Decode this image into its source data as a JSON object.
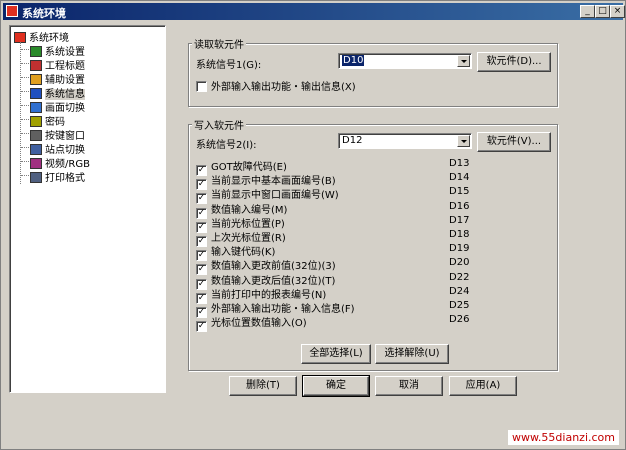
{
  "window": {
    "title": "系统环境",
    "min": "_",
    "max": "□",
    "close": "×"
  },
  "tree": {
    "root": "系统环境",
    "items": [
      {
        "label": "系统设置",
        "icon": "system-settings-icon",
        "selected": false
      },
      {
        "label": "工程标题",
        "icon": "project-title-icon",
        "selected": false
      },
      {
        "label": "辅助设置",
        "icon": "aux-settings-icon",
        "selected": false
      },
      {
        "label": "系统信息",
        "icon": "system-info-icon",
        "selected": true
      },
      {
        "label": "画面切换",
        "icon": "screen-switch-icon",
        "selected": false
      },
      {
        "label": "密码",
        "icon": "key-icon",
        "selected": false
      },
      {
        "label": "按键窗口",
        "icon": "key-window-icon",
        "selected": false
      },
      {
        "label": "站点切换",
        "icon": "station-switch-icon",
        "selected": false
      },
      {
        "label": "视频/RGB",
        "icon": "video-rgb-icon",
        "selected": false
      },
      {
        "label": "打印格式",
        "icon": "print-format-icon",
        "selected": false
      }
    ]
  },
  "read": {
    "title": "读取软元件",
    "signal_label": "系统信号1(G):",
    "signal_value": "D10",
    "device_button": "软元件(D)...",
    "checkbox_label": "外部输入输出功能・输出信息(X)",
    "checkbox_checked": false
  },
  "write": {
    "title": "写入软元件",
    "signal_label": "系统信号2(I):",
    "signal_value": "D12",
    "device_button": "软元件(V)...",
    "items": [
      {
        "label": "GOT故障代码(E)",
        "device": "D13",
        "checked": true
      },
      {
        "label": "当前显示中基本画面编号(B)",
        "device": "D14",
        "checked": true
      },
      {
        "label": "当前显示中窗口画面编号(W)",
        "device": "D15",
        "checked": true
      },
      {
        "label": "数值输入编号(M)",
        "device": "D16",
        "checked": true
      },
      {
        "label": "当前光标位置(P)",
        "device": "D17",
        "checked": true
      },
      {
        "label": "上次光标位置(R)",
        "device": "D18",
        "checked": true
      },
      {
        "label": "输入键代码(K)",
        "device": "D19",
        "checked": true
      },
      {
        "label": "数值输入更改前值(32位)(3)",
        "device": "D20",
        "checked": true
      },
      {
        "label": "数值输入更改后值(32位)(T)",
        "device": "D22",
        "checked": true
      },
      {
        "label": "当前打印中的报表编号(N)",
        "device": "D24",
        "checked": true
      },
      {
        "label": "外部输入输出功能・输入信息(F)",
        "device": "D25",
        "checked": true
      },
      {
        "label": "光标位置数值输入(O)",
        "device": "D26",
        "checked": true
      }
    ],
    "select_all": "全部选择(L)",
    "deselect": "选择解除(U)"
  },
  "footer": {
    "delete": "删除(T)",
    "ok": "确定",
    "cancel": "取消",
    "apply": "应用(A)"
  },
  "watermark": "www.55dianzi.com",
  "colors": {
    "titlebar": "#0a246a",
    "face": "#d4d0c8",
    "watermark": "#c00000"
  }
}
